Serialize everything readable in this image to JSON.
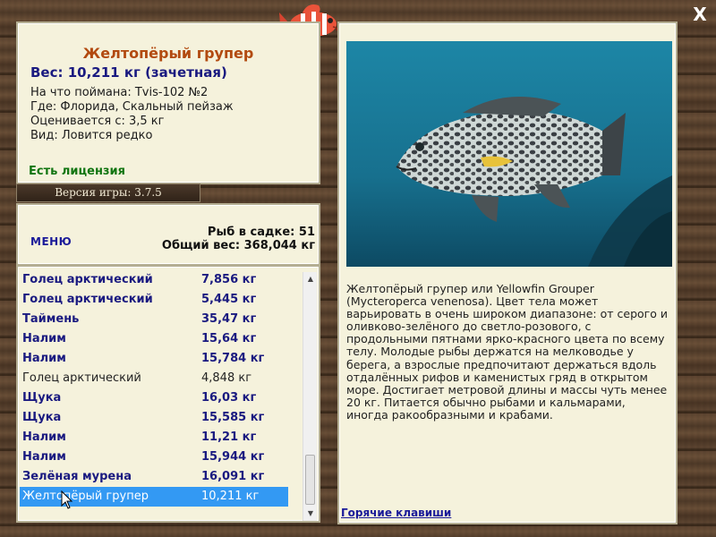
{
  "info": {
    "title": "Желтопёрый групер",
    "weight": "Вес: 10,211 кг (зачетная)",
    "lines": [
      "На что поймана: Tvis-102 №2",
      "Где: Флорида, Скальный пейзаж",
      "Оценивается с: 3,5 кг",
      "Вид: Ловится редко"
    ],
    "license": "Есть лицензия"
  },
  "version": "Версия игры: 3.7.5",
  "stats": {
    "menu": "МЕНЮ",
    "fish_in_keepnet": "Рыб в садке: 51",
    "total_weight": "Общий вес: 368,044 кг"
  },
  "catch_list": [
    {
      "name": "Голец арктический",
      "weight": "7,856 кг",
      "style": "b"
    },
    {
      "name": "Голец арктический",
      "weight": "5,445 кг",
      "style": "b"
    },
    {
      "name": "Таймень",
      "weight": "35,47 кг",
      "style": "b"
    },
    {
      "name": "Налим",
      "weight": "15,64 кг",
      "style": "b"
    },
    {
      "name": "Налим",
      "weight": "15,784 кг",
      "style": "b"
    },
    {
      "name": "Голец арктический",
      "weight": "4,848 кг",
      "style": "p"
    },
    {
      "name": "Щука",
      "weight": "16,03 кг",
      "style": "b"
    },
    {
      "name": "Щука",
      "weight": "15,585 кг",
      "style": "b"
    },
    {
      "name": "Налим",
      "weight": "11,21 кг",
      "style": "b"
    },
    {
      "name": "Налим",
      "weight": "15,944 кг",
      "style": "b"
    },
    {
      "name": "Зелёная мурена",
      "weight": "16,091 кг",
      "style": "b"
    },
    {
      "name": "Желтопёрый групер",
      "weight": "10,211 кг",
      "style": "sel"
    }
  ],
  "description": "Желтопёрый групер или Yellowfin Grouper (Mycteroperca venenosa). Цвет тела может варьировать в очень широком диапазоне: от серого и оливково-зелёного до светло-розового, с продольными пятнами ярко-красного цвета по всему телу. Молодые рыбы держатся на мелководье у берега, а взрослые предпочитают держаться вдоль отдалённых рифов и каменистых гряд в открытом море. Достигает метровой длины и массы чуть менее 20 кг. Питается обычно рыбами и кальмарами, иногда ракообразными и крабами.",
  "hotkeys": "Горячие клавиши",
  "close": "X",
  "colors": {
    "title": "#b24a10",
    "weight": "#1a1a80",
    "license": "#117511",
    "selection": "#3399f3",
    "panel_bg": "#f5f2dc"
  },
  "icons": {
    "logo": "fish-logo-icon",
    "close": "close-icon",
    "scroll_up": "arrow-up-icon",
    "scroll_down": "arrow-down-icon",
    "cursor": "mouse-cursor-icon"
  }
}
